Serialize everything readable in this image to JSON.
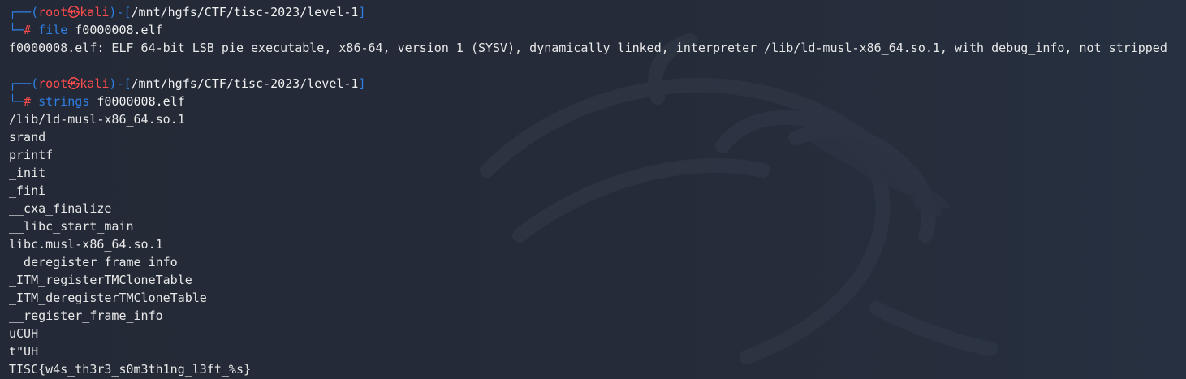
{
  "prompt": {
    "corner_top": "┌──",
    "corner_bottom": "└─",
    "open_paren": "(",
    "close_paren": ")",
    "open_bracket": "-[",
    "close_bracket": "]",
    "user": "root",
    "at_symbol": "㉿",
    "host": "kali",
    "path": "/mnt/hgfs/CTF/tisc-2023/level-1",
    "hash": "#"
  },
  "commands": [
    {
      "cmd": "file",
      "arg": "f0000008.elf",
      "output": [
        "f0000008.elf: ELF 64-bit LSB pie executable, x86-64, version 1 (SYSV), dynamically linked, interpreter /lib/ld-musl-x86_64.so.1, with debug_info, not stripped"
      ]
    },
    {
      "cmd": "strings",
      "arg": "f0000008.elf",
      "output": [
        "/lib/ld-musl-x86_64.so.1",
        "srand",
        "printf",
        "_init",
        "_fini",
        "__cxa_finalize",
        "__libc_start_main",
        "libc.musl-x86_64.so.1",
        "__deregister_frame_info",
        "_ITM_registerTMCloneTable",
        "_ITM_deregisterTMCloneTable",
        "__register_frame_info",
        "uCUH",
        "t\"UH",
        "TISC{w4s_th3r3_s0m3th1ng_l3ft_%s}"
      ]
    }
  ],
  "colors": {
    "background": "#242a37",
    "prompt_blue": "#2f7fe3",
    "prompt_red": "#ff4d4d",
    "text": "#e8e8e8"
  },
  "background_icon": "kali-dragon-icon"
}
